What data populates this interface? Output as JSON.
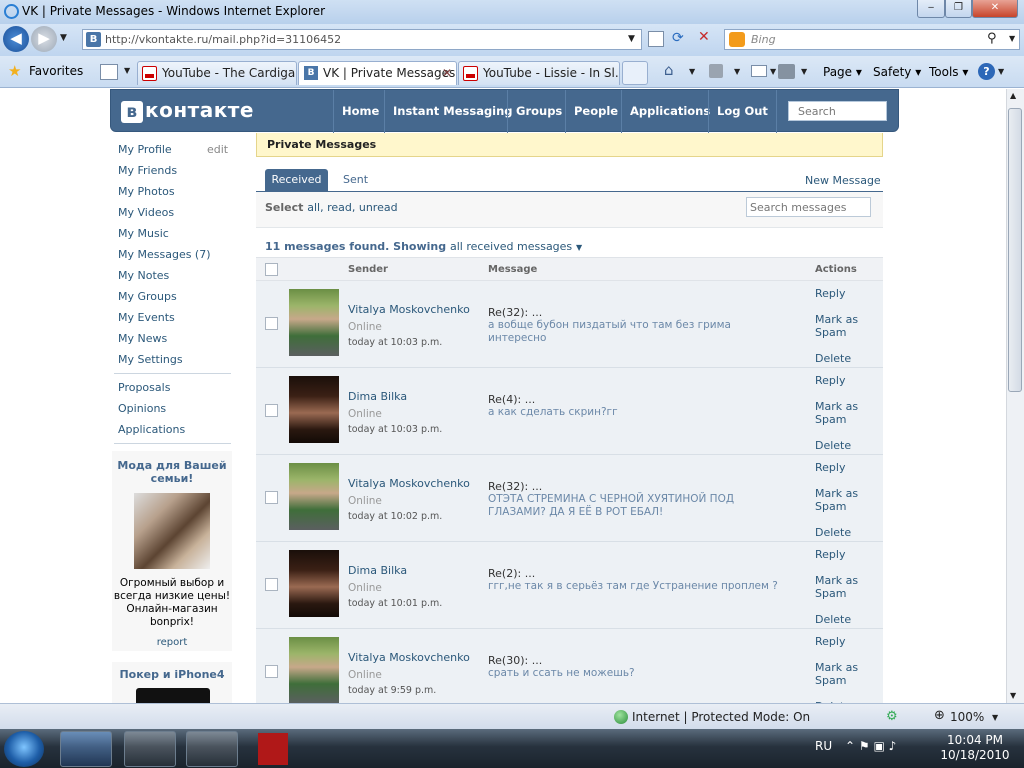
{
  "browser": {
    "title": "VK | Private Messages - Windows Internet Explorer",
    "url": "http://vkontakte.ru/mail.php?id=31106452",
    "search_placeholder": "Bing",
    "favorites_label": "Favorites",
    "tabs": [
      {
        "label": "YouTube - The Cardiga..."
      },
      {
        "label": "VK | Private Messages"
      },
      {
        "label": "YouTube - Lissie - In Sl..."
      }
    ],
    "toolbar": {
      "page": "Page",
      "safety": "Safety",
      "tools": "Tools"
    },
    "status": {
      "zone": "Internet | Protected Mode: On",
      "zoom": "100%"
    }
  },
  "vk": {
    "logo": "контакте",
    "logo_letter": "в",
    "nav": [
      "Home",
      "Instant Messaging",
      "Groups",
      "People",
      "Applications",
      "Log Out"
    ],
    "search_placeholder": "Search",
    "left_menu": [
      "My Profile",
      "My Friends",
      "My Photos",
      "My Videos",
      "My Music",
      "My Messages (7)",
      "My Notes",
      "My Groups",
      "My Events",
      "My News",
      "My Settings"
    ],
    "edit_label": "edit",
    "left_menu2": [
      "Proposals",
      "Opinions",
      "Applications"
    ],
    "ad": {
      "title": "Мода для Вашей семьи!",
      "text": "Огромный выбор и всегда низкие цены! Онлайн-магазин bonprix!",
      "report": "report"
    },
    "ad2": {
      "title": "Покер и iPhone4"
    },
    "page_title": "Private Messages",
    "tab_received": "Received",
    "tab_sent": "Sent",
    "new_message": "New Message",
    "select_label": "Select",
    "select_options": "all, read, unread",
    "search_messages_placeholder": "Search messages",
    "found": "11 messages found. Showing",
    "found_filter": "all received messages",
    "columns": {
      "sender": "Sender",
      "message": "Message",
      "actions": "Actions"
    },
    "actions": {
      "reply": "Reply",
      "spam": "Mark as Spam",
      "delete": "Delete"
    },
    "messages": [
      {
        "sender": "Vitalya Moskovchenko",
        "status": "Online",
        "time": "today at 10:03 p.m.",
        "subject": "Re(32): ...",
        "body": "а вобще бубон пиздатый что там без грима интересно"
      },
      {
        "sender": "Dima Bilka",
        "status": "Online",
        "time": "today at 10:03 p.m.",
        "subject": "Re(4): ...",
        "body": "а как сделать скрин?гг"
      },
      {
        "sender": "Vitalya Moskovchenko",
        "status": "Online",
        "time": "today at 10:02 p.m.",
        "subject": "Re(32): ...",
        "body": "ОТЭТА СТРЕМИНА С ЧЕРНОЙ ХУЯТИНОЙ ПОД ГЛАЗАМИ? ДА Я ЕЁ В РОТ ЕБАЛ!"
      },
      {
        "sender": "Dima Bilka",
        "status": "Online",
        "time": "today at 10:01 p.m.",
        "subject": "Re(2): ...",
        "body": "ггг,не так я в серьёз там где Устранение проплем ?"
      },
      {
        "sender": "Vitalya Moskovchenko",
        "status": "Online",
        "time": "today at 9:59 p.m.",
        "subject": "Re(30): ...",
        "body": "срать и ссать не можешь?"
      }
    ]
  },
  "taskbar": {
    "lang": "RU",
    "time": "10:04 PM",
    "date": "10/18/2010"
  }
}
